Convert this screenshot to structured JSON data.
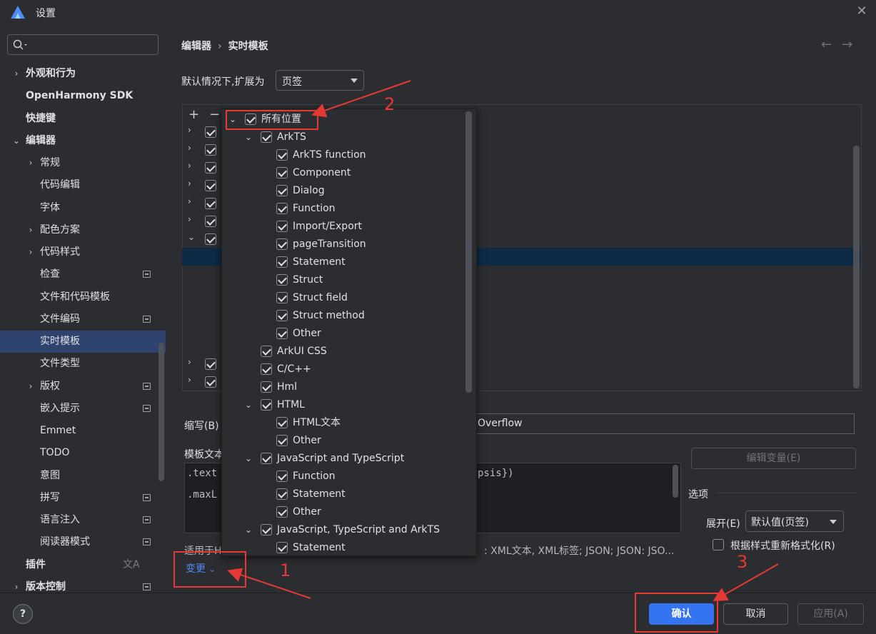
{
  "window": {
    "title": "设置",
    "close_glyph": "✕"
  },
  "sidebar": {
    "search_placeholder": "",
    "items": [
      {
        "label": "外观和行为",
        "arrow": "›",
        "level": 0,
        "bold": true
      },
      {
        "label": "OpenHarmony SDK",
        "arrow": "",
        "level": 0,
        "bold": true
      },
      {
        "label": "快捷键",
        "arrow": "",
        "level": 0,
        "bold": true
      },
      {
        "label": "编辑器",
        "arrow": "⌄",
        "level": 0,
        "bold": true
      },
      {
        "label": "常规",
        "arrow": "›",
        "level": 1
      },
      {
        "label": "代码编辑",
        "arrow": "",
        "level": 1
      },
      {
        "label": "字体",
        "arrow": "",
        "level": 1
      },
      {
        "label": "配色方案",
        "arrow": "›",
        "level": 1
      },
      {
        "label": "代码样式",
        "arrow": "›",
        "level": 1
      },
      {
        "label": "检查",
        "arrow": "",
        "level": 1,
        "badge": true
      },
      {
        "label": "文件和代码模板",
        "arrow": "",
        "level": 1
      },
      {
        "label": "文件编码",
        "arrow": "",
        "level": 1,
        "badge": true
      },
      {
        "label": "实时模板",
        "arrow": "",
        "level": 1,
        "selected": true
      },
      {
        "label": "文件类型",
        "arrow": "",
        "level": 1
      },
      {
        "label": "版权",
        "arrow": "›",
        "level": 1,
        "badge": true
      },
      {
        "label": "嵌入提示",
        "arrow": "",
        "level": 1,
        "badge": true
      },
      {
        "label": "Emmet",
        "arrow": "",
        "level": 1
      },
      {
        "label": "TODO",
        "arrow": "",
        "level": 1
      },
      {
        "label": "意图",
        "arrow": "",
        "level": 1
      },
      {
        "label": "拼写",
        "arrow": "",
        "level": 1,
        "badge": true
      },
      {
        "label": "语言注入",
        "arrow": "",
        "level": 1,
        "badge": true
      },
      {
        "label": "阅读器模式",
        "arrow": "",
        "level": 1,
        "badge": true
      },
      {
        "label": "插件",
        "arrow": "",
        "level": 0,
        "bold": true,
        "translate_icon": true
      },
      {
        "label": "版本控制",
        "arrow": "›",
        "level": 0,
        "bold": true,
        "badge": true
      }
    ]
  },
  "breadcrumb": {
    "parent": "编辑器",
    "separator": "›",
    "current": "实时模板",
    "back": "←",
    "forward": "→"
  },
  "expand": {
    "label": "默认情况下,扩展为",
    "value": "页签"
  },
  "tree_toolbar": {
    "add": "+",
    "remove": "−"
  },
  "abbreviation": {
    "label": "缩写(B)",
    "value": "Overflow"
  },
  "template_text": {
    "label": "模板文本",
    "line1_start": ".text",
    "line1_end": "psis})",
    "line2_start": ".maxL"
  },
  "edit_variables": "编辑变量(E)",
  "options": {
    "title": "选项",
    "expand_label": "展开(E)",
    "expand_value": "默认值(页签)",
    "reformat_label": "根据样式重新格式化(R)",
    "reformat_checked": false
  },
  "applicable": {
    "label": "适用于H",
    "value": ": XML文本, XML标签; JSON; JSON: JSO..."
  },
  "change_link": "变更",
  "buttons": {
    "ok": "确认",
    "cancel": "取消",
    "apply": "应用(A)",
    "help": "?"
  },
  "context_popup": {
    "items": [
      {
        "label": "所有位置",
        "level": 0,
        "arrow": "⌄"
      },
      {
        "label": "ArkTS",
        "level": 1,
        "arrow": "⌄"
      },
      {
        "label": "ArkTS function",
        "level": 2
      },
      {
        "label": "Component",
        "level": 2
      },
      {
        "label": "Dialog",
        "level": 2
      },
      {
        "label": "Function",
        "level": 2
      },
      {
        "label": "Import/Export",
        "level": 2
      },
      {
        "label": "pageTransition",
        "level": 2
      },
      {
        "label": "Statement",
        "level": 2
      },
      {
        "label": "Struct",
        "level": 2
      },
      {
        "label": "Struct field",
        "level": 2
      },
      {
        "label": "Struct method",
        "level": 2
      },
      {
        "label": "Other",
        "level": 2
      },
      {
        "label": "ArkUI CSS",
        "level": 1
      },
      {
        "label": "C/C++",
        "level": 1
      },
      {
        "label": "Hml",
        "level": 1
      },
      {
        "label": "HTML",
        "level": 1,
        "arrow": "⌄"
      },
      {
        "label": "HTML文本",
        "level": 2
      },
      {
        "label": "Other",
        "level": 2
      },
      {
        "label": "JavaScript and TypeScript",
        "level": 1,
        "arrow": "⌄"
      },
      {
        "label": "Function",
        "level": 2
      },
      {
        "label": "Statement",
        "level": 2
      },
      {
        "label": "Other",
        "level": 2
      },
      {
        "label": "JavaScript, TypeScript and ArkTS",
        "level": 1,
        "arrow": "⌄"
      },
      {
        "label": "Statement",
        "level": 2
      }
    ]
  },
  "annotations": {
    "n1": "1",
    "n2": "2",
    "n3": "3",
    "color": "#e53935"
  }
}
